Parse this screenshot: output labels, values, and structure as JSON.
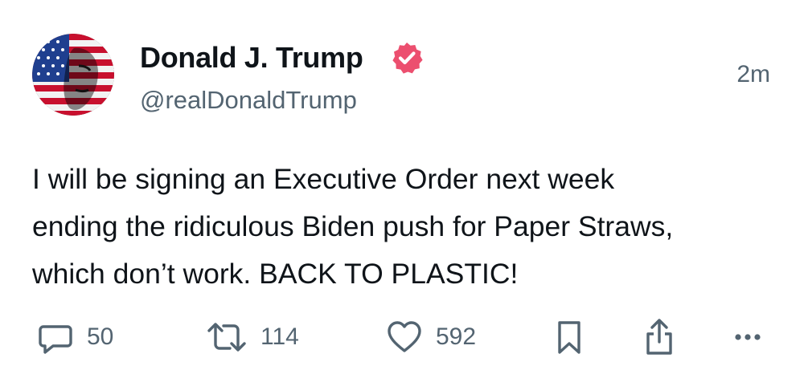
{
  "post": {
    "author": {
      "display_name": "Donald J. Trump",
      "handle": "@realDonaldTrump",
      "verified_badge_icon": "verified-badge-icon",
      "avatar": "american-flag-portrait-avatar"
    },
    "timestamp": "2m",
    "body_lines": [
      "I will be signing an Executive Order next week",
      "ending the ridiculous Biden push for Paper Straws,",
      "which don’t work. BACK TO PLASTIC!"
    ],
    "actions": {
      "reply": {
        "icon": "reply-icon",
        "count": "50"
      },
      "repost": {
        "icon": "repost-icon",
        "count": "114"
      },
      "like": {
        "icon": "heart-icon",
        "count": "592"
      },
      "bookmark": {
        "icon": "bookmark-icon"
      },
      "share": {
        "icon": "share-icon"
      },
      "more": {
        "icon": "more-icon"
      }
    },
    "colors": {
      "text": "#0f1419",
      "secondary": "#536471",
      "verified_badge": "#ec4f6f"
    }
  }
}
